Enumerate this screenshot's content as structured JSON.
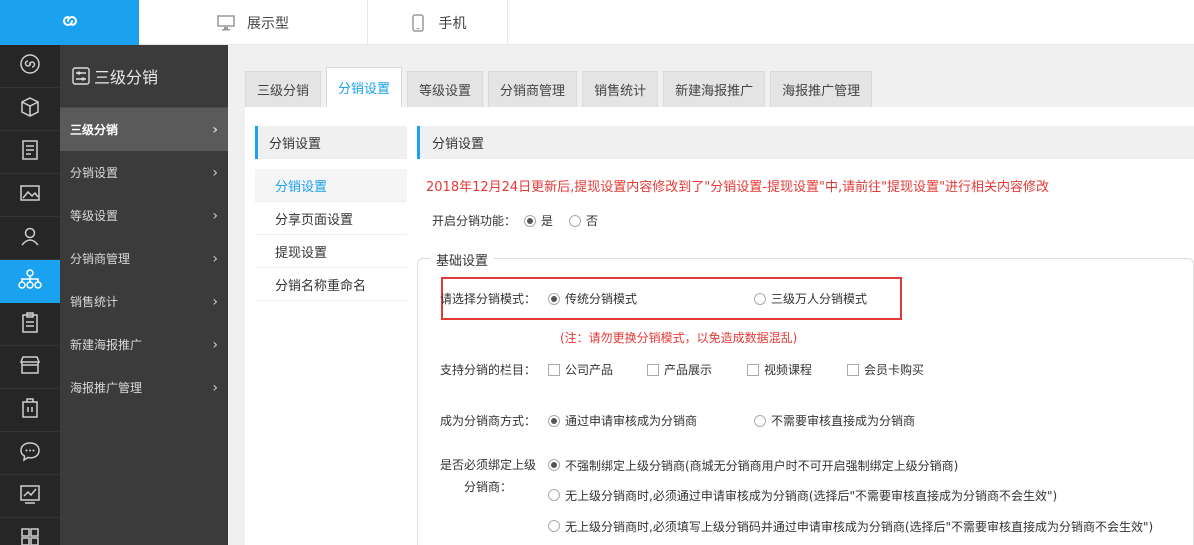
{
  "topbar": {
    "tabs": [
      {
        "label": "展示型",
        "icon": "monitor-icon"
      },
      {
        "label": "手机",
        "icon": "phone-icon"
      }
    ]
  },
  "rail": {
    "icons": [
      "logo-icon",
      "box-icon",
      "document-icon",
      "image-icon",
      "user-icon",
      "network-icon",
      "clipboard-icon",
      "store-icon",
      "building-icon",
      "chat-icon",
      "chart-icon",
      "grid-icon"
    ],
    "active_index": 5
  },
  "submenu": {
    "title": "三级分销",
    "items": [
      {
        "label": "三级分销",
        "active": true
      },
      {
        "label": "分销设置"
      },
      {
        "label": "等级设置"
      },
      {
        "label": "分销商管理"
      },
      {
        "label": "销售统计"
      },
      {
        "label": "新建海报推广"
      },
      {
        "label": "海报推广管理"
      }
    ]
  },
  "tabs": [
    {
      "label": "三级分销"
    },
    {
      "label": "分销设置",
      "active": true
    },
    {
      "label": "等级设置"
    },
    {
      "label": "分销商管理"
    },
    {
      "label": "销售统计"
    },
    {
      "label": "新建海报推广"
    },
    {
      "label": "海报推广管理"
    }
  ],
  "leftnav": {
    "title": "分销设置",
    "items": [
      {
        "label": "分销设置",
        "active": true
      },
      {
        "label": "分享页面设置"
      },
      {
        "label": "提现设置"
      },
      {
        "label": "分销名称重命名"
      }
    ]
  },
  "panel": {
    "title": "分销设置",
    "notice": "2018年12月24日更新后,提现设置内容修改到了\"分销设置-提现设置\"中,请前往\"提现设置\"进行相关内容修改",
    "enable": {
      "label": "开启分销功能：",
      "yes": "是",
      "no": "否",
      "selected": "yes"
    },
    "basic": {
      "legend": "基础设置",
      "mode": {
        "label": "请选择分销模式：",
        "option1": "传统分销模式",
        "option2": "三级万人分销模式",
        "selected": 1,
        "warning": "(注：请勿更换分销模式，以免造成数据混乱)"
      },
      "columns": {
        "label": "支持分销的栏目：",
        "options": [
          "公司产品",
          "产品展示",
          "视频课程",
          "会员卡购买"
        ]
      },
      "become": {
        "label": "成为分销商方式：",
        "option1": "通过申请审核成为分销商",
        "option2": "不需要审核直接成为分销商",
        "selected": 1
      },
      "bind": {
        "label_line1": "是否必须绑定上级",
        "label_line2": "分销商：",
        "option1": "不强制绑定上级分销商(商城无分销商用户时不可开启强制绑定上级分销商)",
        "option2": "无上级分销商时,必须通过申请审核成为分销商(选择后\"不需要审核直接成为分销商不会生效\")",
        "option3": "无上级分销商时,必须填写上级分销码并通过申请审核成为分销商(选择后\"不需要审核直接成为分销商不会生效\")",
        "selected": 1
      }
    }
  }
}
